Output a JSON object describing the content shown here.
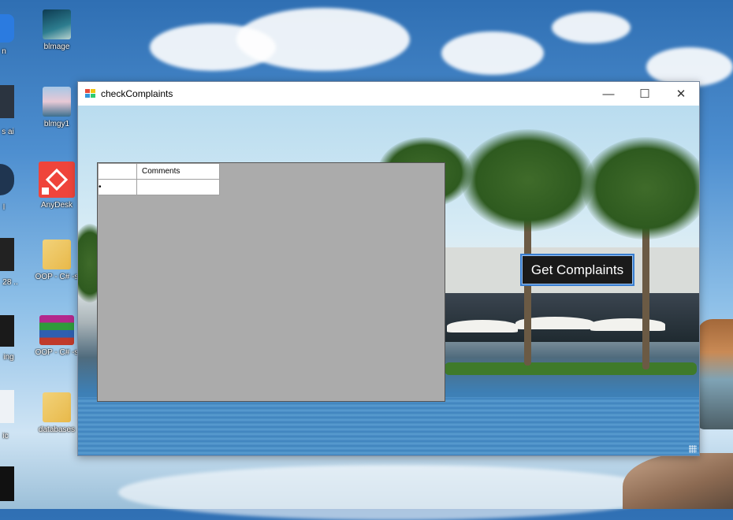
{
  "desktop": {
    "icons": [
      {
        "label": "blmage"
      },
      {
        "label": "blmgy1"
      },
      {
        "label": "AnyDesk"
      },
      {
        "label": "OOP - C# -s"
      },
      {
        "label": "OOP - C# -s"
      },
      {
        "label": "databases"
      }
    ],
    "edge_labels": [
      "n",
      "s ai",
      "l",
      "28 ..",
      "ing",
      "ic"
    ]
  },
  "window": {
    "title": "checkComplaints",
    "controls": {
      "minimize": "—",
      "maximize": "☐",
      "close": "✕"
    }
  },
  "grid": {
    "columns": [
      "Comments"
    ],
    "new_row_marker": "•"
  },
  "button": {
    "label": "Get Complaints"
  },
  "colors": {
    "button_bg": "#1a1a1a",
    "button_border": "#3a7fd1",
    "grid_bg": "#ababab"
  }
}
